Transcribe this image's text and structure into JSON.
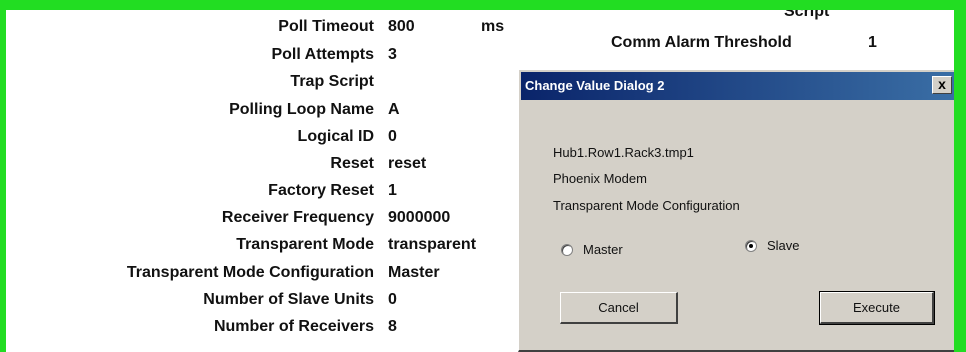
{
  "properties": [
    {
      "label": "Poll Timeout",
      "value": "800",
      "unit": "ms"
    },
    {
      "label": "Poll Attempts",
      "value": "3"
    },
    {
      "label": "Trap Script",
      "value": ""
    },
    {
      "label": "Polling Loop Name",
      "value": "A"
    },
    {
      "label": "Logical ID",
      "value": "0"
    },
    {
      "label": "Reset",
      "value": "reset"
    },
    {
      "label": "Factory Reset",
      "value": "1"
    },
    {
      "label": "Receiver Frequency",
      "value": "9000000"
    },
    {
      "label": "Transparent Mode",
      "value": "transparent"
    },
    {
      "label": "Transparent Mode Configuration",
      "value": "Master"
    },
    {
      "label": "Number of Slave Units",
      "value": "0"
    },
    {
      "label": "Number of Receivers",
      "value": "8"
    }
  ],
  "right_column": {
    "script_label": "Script",
    "comm_alarm_label": "Comm Alarm Threshold",
    "comm_alarm_value": "1"
  },
  "dialog": {
    "title": "Change Value Dialog 2",
    "close_glyph": "x",
    "path": "Hub1.Row1.Rack3.tmp1",
    "device": "Phoenix Modem",
    "setting": "Transparent Mode Configuration",
    "options": [
      {
        "label": "Master",
        "selected": false
      },
      {
        "label": "Slave",
        "selected": true
      }
    ],
    "cancel_label": "Cancel",
    "execute_label": "Execute"
  },
  "colors": {
    "frame": "#22dd22",
    "titlebar": "#0a246a",
    "dialog_face": "#d4d0c8"
  }
}
